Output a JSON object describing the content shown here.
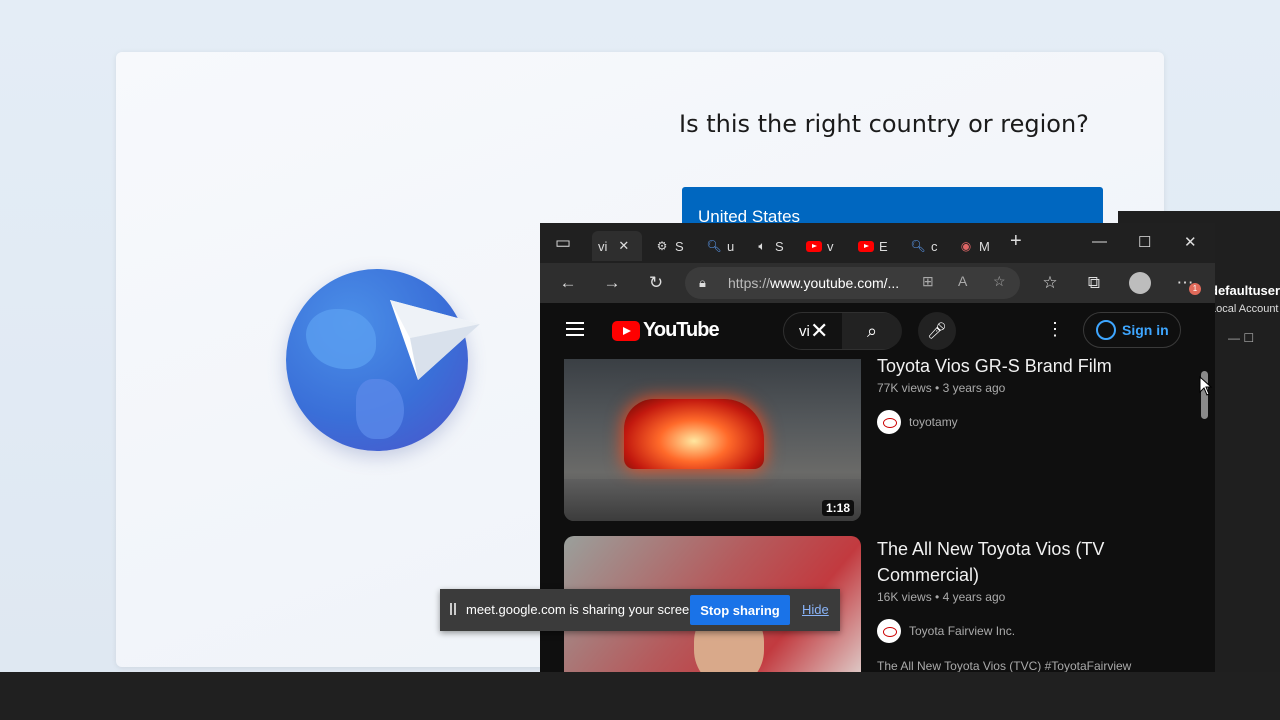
{
  "oobe": {
    "title": "Is this the right country or region?",
    "selected_country": "United States"
  },
  "back_window": {
    "user": "defaultuser",
    "account": "Local Account",
    "controls": "—   ☐"
  },
  "browser": {
    "tabs": [
      {
        "label": "vi",
        "icon": "tab-favicon",
        "active": true
      },
      {
        "label": "S",
        "icon": "gear-icon"
      },
      {
        "label": "u",
        "icon": "search-icon"
      },
      {
        "label": "S",
        "icon": "speaker-icon"
      },
      {
        "label": "v",
        "icon": "youtube-icon"
      },
      {
        "label": "E",
        "icon": "youtube-icon"
      },
      {
        "label": "c",
        "icon": "search-icon"
      },
      {
        "label": "M",
        "icon": "record-icon"
      }
    ],
    "close_tab": "✕",
    "new_tab": "+",
    "window_controls": {
      "minimize": "—",
      "maximize": "☐",
      "close": "✕"
    },
    "url_prefix": "https://",
    "url_host": "www.youtube.com/...",
    "notification_badge": "1"
  },
  "youtube": {
    "logo_text": "YouTube",
    "search_query": "vi",
    "sign_in": "Sign in",
    "results": [
      {
        "title": "Toyota Vios GR-S Brand Film",
        "views": "77K views",
        "age": "3 years ago",
        "channel": "toyotamy",
        "duration": "1:18"
      },
      {
        "title": "The All New Toyota Vios (TV Commercial)",
        "views": "16K views",
        "age": "4 years ago",
        "channel": "Toyota Fairview Inc.",
        "description": "The All New Toyota Vios (TVC) #ToyotaFairview"
      }
    ]
  },
  "share_bar": {
    "message": "meet.google.com is sharing your screen.",
    "stop_label": "Stop sharing",
    "hide_label": "Hide"
  }
}
